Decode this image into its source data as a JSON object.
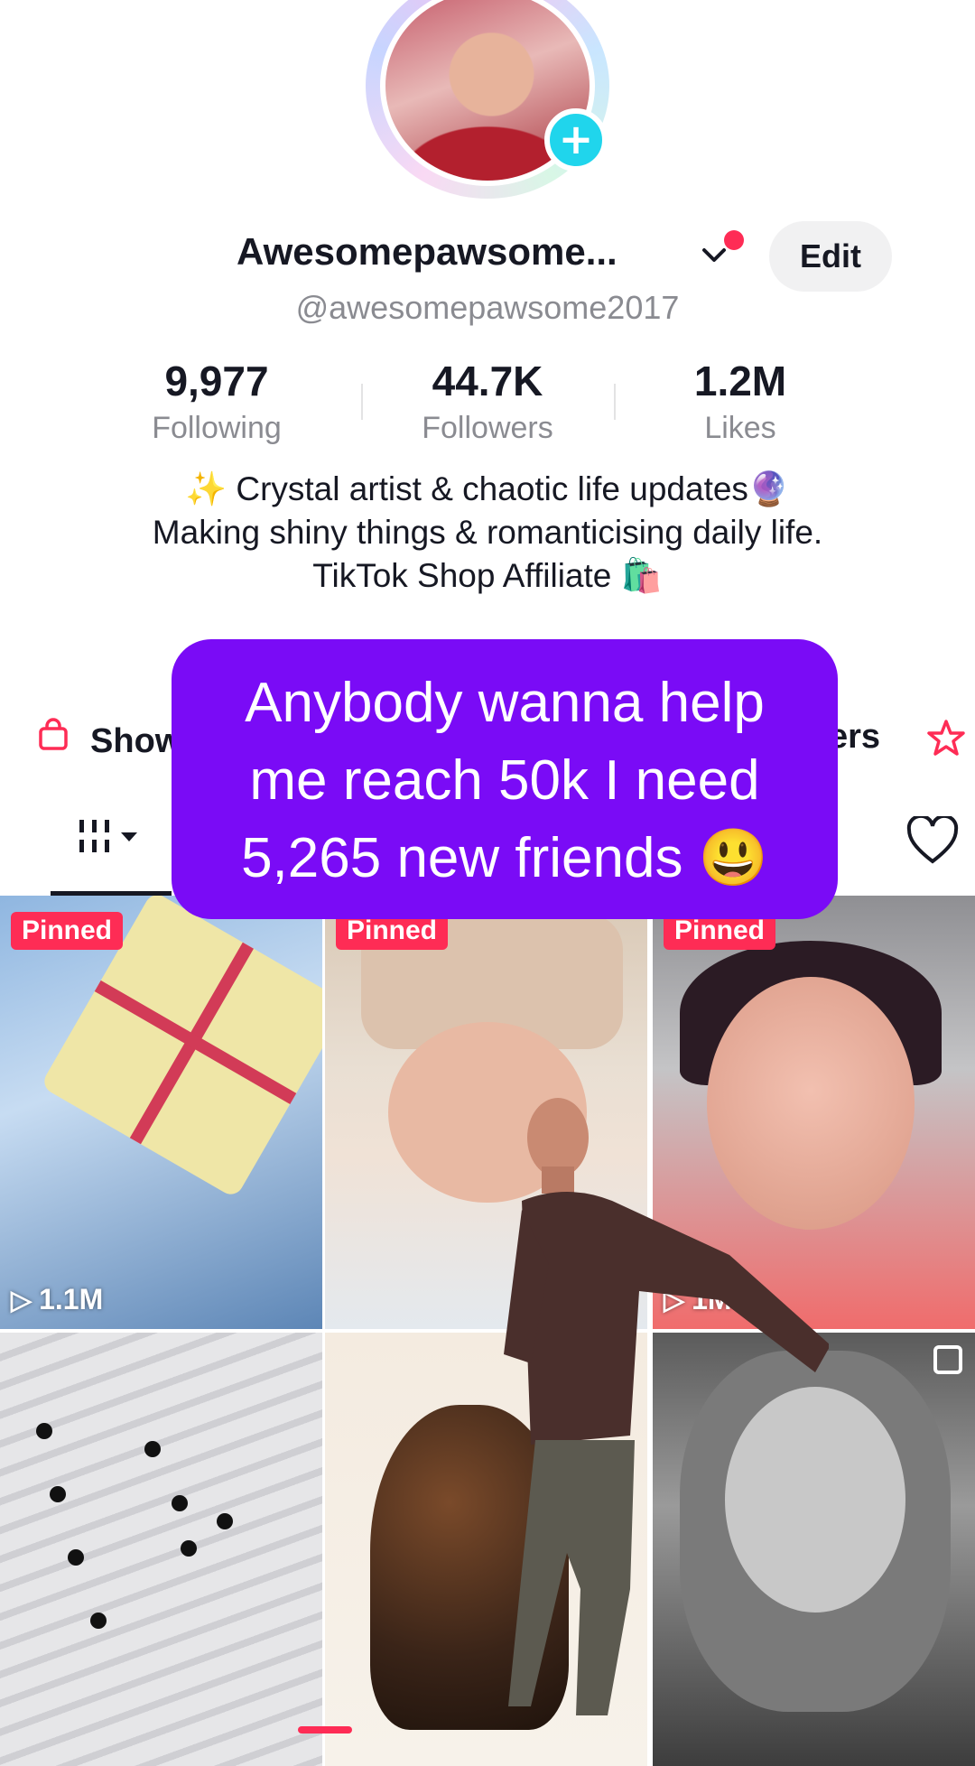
{
  "profile": {
    "display_name": "Awesomepawsome...",
    "handle": "@awesomepawsome2017",
    "edit_label": "Edit",
    "avatar_plus": "+",
    "chevron": "⌄"
  },
  "stats": [
    {
      "value": "9,977",
      "label": "Following"
    },
    {
      "value": "44.7K",
      "label": "Followers"
    },
    {
      "value": "1.2M",
      "label": "Likes"
    }
  ],
  "bio": {
    "line1": "✨ Crystal artist & chaotic life updates🔮",
    "line2": "Making shiny things & romanticising daily life.",
    "line3": "TikTok Shop Affiliate 🛍️"
  },
  "links": {
    "shop_label": "Show",
    "right_label": "ers"
  },
  "overlay": {
    "line1": "Anybody wanna help",
    "line2": "me reach 50k I need",
    "line3": "5,265 new friends 😃"
  },
  "videos": [
    {
      "pinned": "Pinned",
      "views": "1.1M"
    },
    {
      "pinned": "Pinned",
      "views": ""
    },
    {
      "pinned": "Pinned",
      "views": "1M"
    },
    {
      "pinned": "",
      "views": ""
    },
    {
      "pinned": "",
      "views": ""
    },
    {
      "pinned": "",
      "views": ""
    }
  ],
  "colors": {
    "accent": "#fe2c55",
    "overlay_bg": "#7a0bf6",
    "plus_badge": "#20d5ec"
  },
  "icons": {
    "shop": "shopping-bag-icon",
    "star": "star-icon",
    "grid": "grid-icon",
    "heart": "heart-icon",
    "play": "play-icon"
  }
}
